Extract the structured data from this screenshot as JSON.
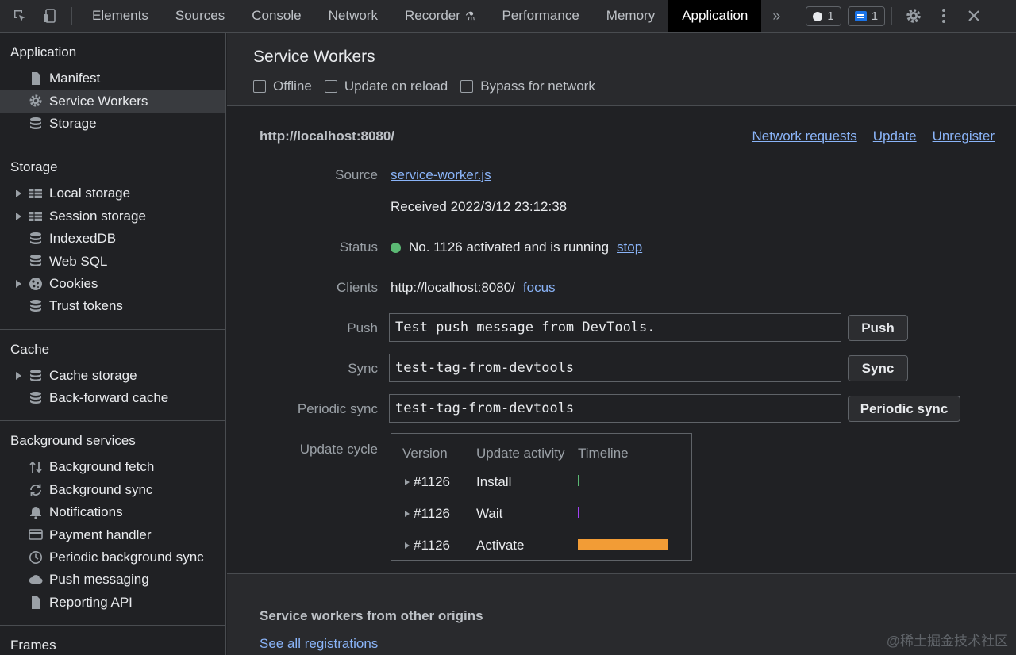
{
  "toolbar": {
    "tabs": [
      "Elements",
      "Sources",
      "Console",
      "Network",
      "Recorder",
      "Performance",
      "Memory",
      "Application"
    ],
    "active_tab": "Application",
    "issues_count": "1",
    "messages_count": "1"
  },
  "sidebar": {
    "application": {
      "title": "Application",
      "items": [
        "Manifest",
        "Service Workers",
        "Storage"
      ]
    },
    "storage": {
      "title": "Storage",
      "items": [
        "Local storage",
        "Session storage",
        "IndexedDB",
        "Web SQL",
        "Cookies",
        "Trust tokens"
      ]
    },
    "cache": {
      "title": "Cache",
      "items": [
        "Cache storage",
        "Back-forward cache"
      ]
    },
    "background": {
      "title": "Background services",
      "items": [
        "Background fetch",
        "Background sync",
        "Notifications",
        "Payment handler",
        "Periodic background sync",
        "Push messaging",
        "Reporting API"
      ]
    },
    "frames": {
      "title": "Frames"
    }
  },
  "main": {
    "title": "Service Workers",
    "options": [
      "Offline",
      "Update on reload",
      "Bypass for network"
    ],
    "origin": "http://localhost:8080/",
    "actions": [
      "Network requests",
      "Update",
      "Unregister"
    ],
    "source_label": "Source",
    "source_link": "service-worker.js",
    "received": "Received 2022/3/12 23:12:38",
    "status_label": "Status",
    "status_text": "No. 1126 activated and is running",
    "status_link": "stop",
    "clients_label": "Clients",
    "clients_value": "http://localhost:8080/",
    "clients_link": "focus",
    "push_label": "Push",
    "push_value": "Test push message from DevTools.",
    "push_button": "Push",
    "sync_label": "Sync",
    "sync_value": "test-tag-from-devtools",
    "sync_button": "Sync",
    "periodic_label": "Periodic sync",
    "periodic_value": "test-tag-from-devtools",
    "periodic_button": "Periodic sync",
    "cycle_label": "Update cycle",
    "cycle": {
      "headers": [
        "Version",
        "Update activity",
        "Timeline"
      ],
      "rows": [
        {
          "version": "#1126",
          "activity": "Install"
        },
        {
          "version": "#1126",
          "activity": "Wait"
        },
        {
          "version": "#1126",
          "activity": "Activate"
        }
      ]
    },
    "other_title": "Service workers from other origins",
    "other_link": "See all registrations"
  },
  "watermark": "@稀土掘金技术社区",
  "colors": {
    "accent": "#8ab4f8",
    "running": "#5bb974",
    "install": "#5bb974",
    "wait": "#a142f4",
    "activate": "#f29c36"
  }
}
